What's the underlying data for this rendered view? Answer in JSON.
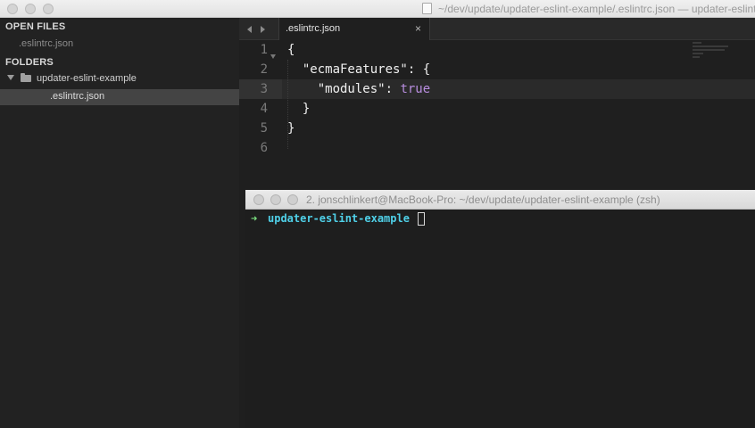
{
  "window": {
    "title": "~/dev/update/updater-eslint-example/.eslintrc.json — updater-eslint-example"
  },
  "sidebar": {
    "open_files_heading": "OPEN FILES",
    "open_files": [
      ".eslintrc.json"
    ],
    "folders_heading": "FOLDERS",
    "folder": {
      "name": "updater-eslint-example",
      "expanded": true
    },
    "files": [
      {
        "name": ".eslintrc.json",
        "selected": true
      }
    ]
  },
  "tabs": [
    {
      "label": ".eslintrc.json",
      "close": "×",
      "active": true
    }
  ],
  "editor": {
    "line_numbers": [
      "1",
      "2",
      "3",
      "4",
      "5",
      "6"
    ],
    "current_line": 3,
    "code": {
      "l1": "{",
      "l2_key": "\"ecmaFeatures\"",
      "l2_rest": ": {",
      "l3_key": "\"modules\"",
      "l3_colon": ": ",
      "l3_value": "true",
      "l4": "}",
      "l5": "}"
    }
  },
  "terminal": {
    "title": "2. jonschlinkert@MacBook-Pro: ~/dev/update/updater-eslint-example (zsh)",
    "prompt_symbol": "➜",
    "directory": "updater-eslint-example"
  },
  "colors": {
    "prompt_arrow": "#7be080",
    "prompt_dir": "#4fd0e8",
    "boolean": "#b98ee0",
    "selected_file_bg": "#444444"
  }
}
